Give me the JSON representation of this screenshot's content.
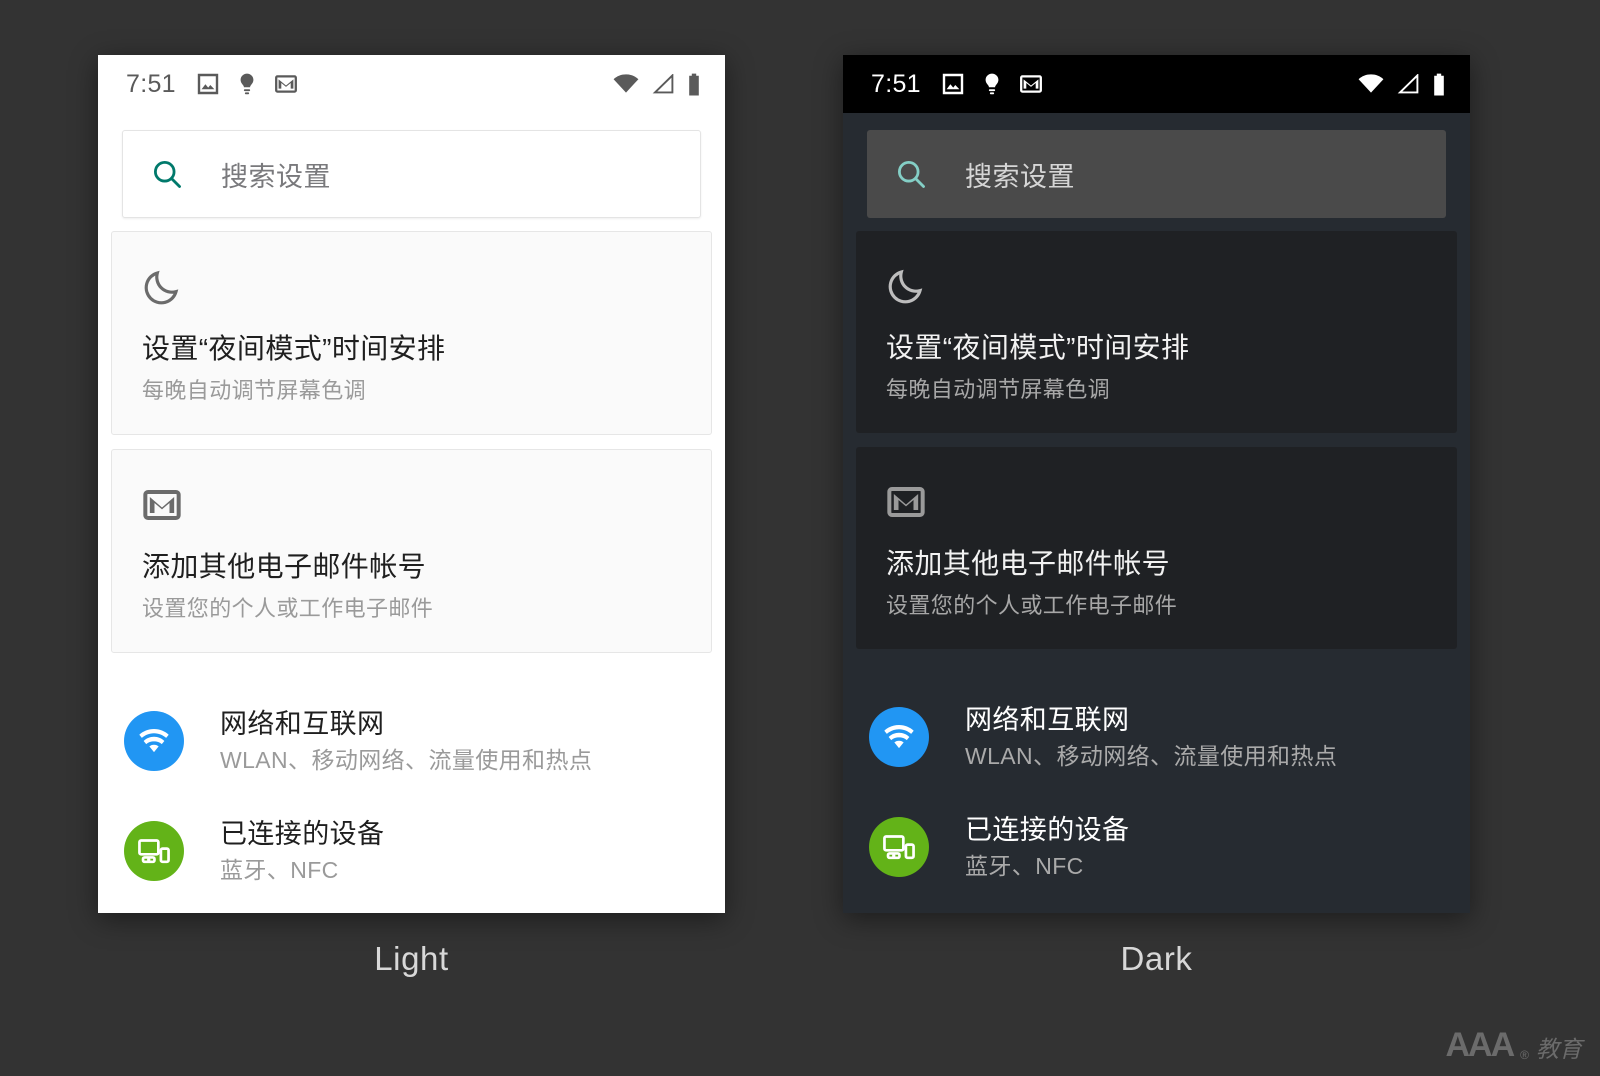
{
  "page": {
    "background_color": "#333333",
    "captions": {
      "light": "Light",
      "dark": "Dark"
    },
    "watermark": {
      "brand": "AAA",
      "registered": "®",
      "suffix": "教育"
    }
  },
  "status_bar": {
    "time": "7:51",
    "left_icons": [
      "image-icon",
      "lightbulb-icon",
      "gmail-icon"
    ],
    "right_icons": [
      "wifi-icon",
      "signal-icon",
      "battery-icon"
    ]
  },
  "search": {
    "icon": "search-icon",
    "placeholder": "搜索设置",
    "value": ""
  },
  "suggestion_cards": [
    {
      "icon": "moon-icon",
      "title": "设置“夜间模式”时间安排",
      "subtitle": "每晚自动调节屏幕色调"
    },
    {
      "icon": "gmail-icon",
      "title": "添加其他电子邮件帐号",
      "subtitle": "设置您的个人或工作电子邮件"
    }
  ],
  "settings_list": [
    {
      "icon": "wifi-circle-icon",
      "icon_color": "#2196F3",
      "title": "网络和互联网",
      "subtitle": "WLAN、移动网络、流量使用和热点"
    },
    {
      "icon": "devices-circle-icon",
      "icon_color": "#63B318",
      "title": "已连接的设备",
      "subtitle": "蓝牙、NFC"
    }
  ],
  "themes": {
    "light": {
      "name": "Light",
      "surface": "#FFFFFF",
      "card": "#FAFAFA",
      "status_bar": "#FFFFFF",
      "accent": "#00796B",
      "title_text": "#1F1F1F",
      "secondary_text": "#9A9A9A"
    },
    "dark": {
      "name": "Dark",
      "surface": "#262B31",
      "card": "#1F2124",
      "status_bar": "#000000",
      "search_field": "#4A4A4A",
      "accent": "#84CFC6",
      "title_text": "#FFFFFF",
      "secondary_text": "#AAAAAA"
    }
  }
}
